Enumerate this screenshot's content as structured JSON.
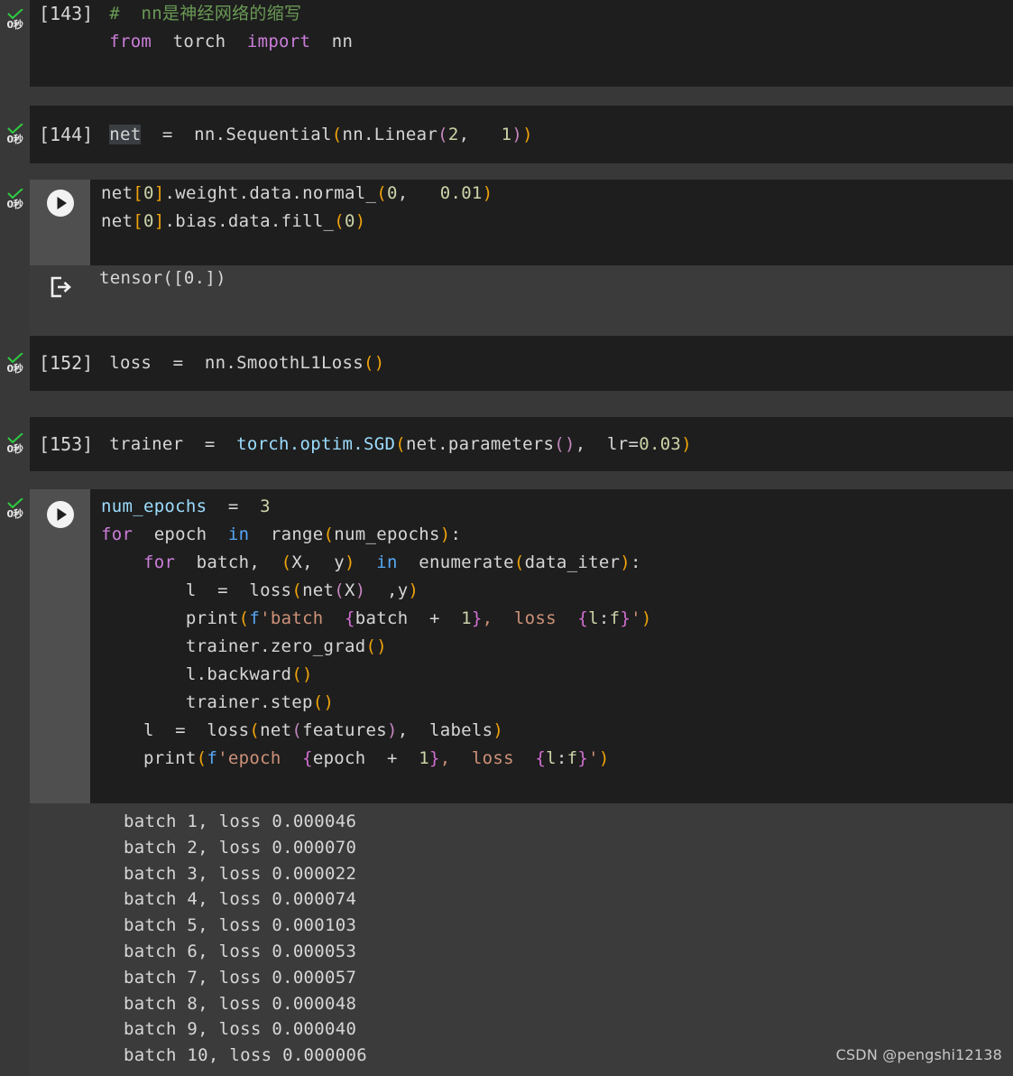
{
  "watermark": "CSDN @pengshi12138",
  "icons": {
    "check": "check-icon",
    "play": "play-icon",
    "output": "output-arrow-icon"
  },
  "elapsed_label": "0秒",
  "cells": [
    {
      "id": "cell-143",
      "exec_count": "[143]",
      "lines": [
        "# nn是神经网络的缩写",
        "from torch import nn"
      ]
    },
    {
      "id": "cell-144",
      "exec_count": "[144]",
      "lines": [
        "net = nn.Sequential(nn.Linear(2, 1))"
      ],
      "selected_token": "net"
    },
    {
      "id": "cell-init",
      "exec_count": "",
      "lines": [
        "net[0].weight.data.normal_(0, 0.01)",
        "net[0].bias.data.fill_(0)"
      ],
      "output": "tensor([0.])"
    },
    {
      "id": "cell-152",
      "exec_count": "[152]",
      "lines": [
        "loss = nn.SmoothL1Loss()"
      ]
    },
    {
      "id": "cell-153",
      "exec_count": "[153]",
      "lines": [
        "trainer = torch.optim.SGD(net.parameters(), lr=0.03)"
      ]
    },
    {
      "id": "cell-train",
      "exec_count": "",
      "lines": [
        "num_epochs = 3",
        "for epoch in range(num_epochs):",
        "    for batch, (X, y) in enumerate(data_iter):",
        "        l = loss(net(X) ,y)",
        "        print(f'batch {batch + 1}, loss {l:f}')",
        "        trainer.zero_grad()",
        "        l.backward()",
        "        trainer.step()",
        "    l = loss(net(features), labels)",
        "    print(f'epoch {epoch + 1}, loss {l:f}')"
      ]
    }
  ],
  "stream_output": {
    "lines": [
      "batch 1, loss 0.000046",
      "batch 2, loss 0.000070",
      "batch 3, loss 0.000022",
      "batch 4, loss 0.000074",
      "batch 5, loss 0.000103",
      "batch 6, loss 0.000053",
      "batch 7, loss 0.000057",
      "batch 8, loss 0.000048",
      "batch 9, loss 0.000040",
      "batch 10, loss 0.000006"
    ]
  },
  "colors": {
    "background": "#383838",
    "code_background": "#1e1e1e",
    "output_background": "#3b3b3b",
    "gutter": "#4f4f4f",
    "text": "#d6d6d6",
    "keyword": "#cc7eda",
    "keyword_alt": "#56a8f5",
    "comment": "#6a9955",
    "string": "#ce9178",
    "number": "#cbd4a8",
    "paren": "#f0a30a",
    "check": "#2ecc40"
  }
}
